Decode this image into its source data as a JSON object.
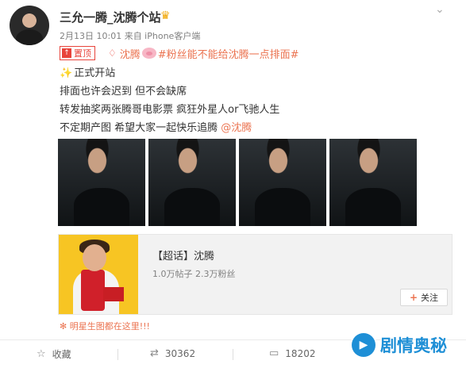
{
  "header": {
    "username": "三允一腾_沈腾个站",
    "meta": "2月13日 10:01 来自 iPhone客户端"
  },
  "post": {
    "pinned_label": "置顶",
    "mention_name": "沈腾",
    "hashtag": "#粉丝能不能给沈腾一点排面#",
    "line2": "正式开站",
    "line3": "排面也许会迟到 但不会缺席",
    "line4": "转发抽奖两张腾哥电影票 疯狂外星人or飞驰人生",
    "line5_text": "不定期产图 希望大家一起快乐追腾 ",
    "line5_mention": "@沈腾"
  },
  "card": {
    "title": "【超话】沈腾",
    "stats": "1.0万帖子 2.3万粉丝",
    "follow_label": "关注"
  },
  "star_link": "明星生图都在这里!!!",
  "footer": {
    "favorite_label": "收藏",
    "repost_count": "30362",
    "comment_count": "18202"
  },
  "watermark": "剧情奥秘",
  "colors": {
    "accent": "#eb7350",
    "pinned": "#e8443b",
    "watermark": "#1e8fd6"
  }
}
